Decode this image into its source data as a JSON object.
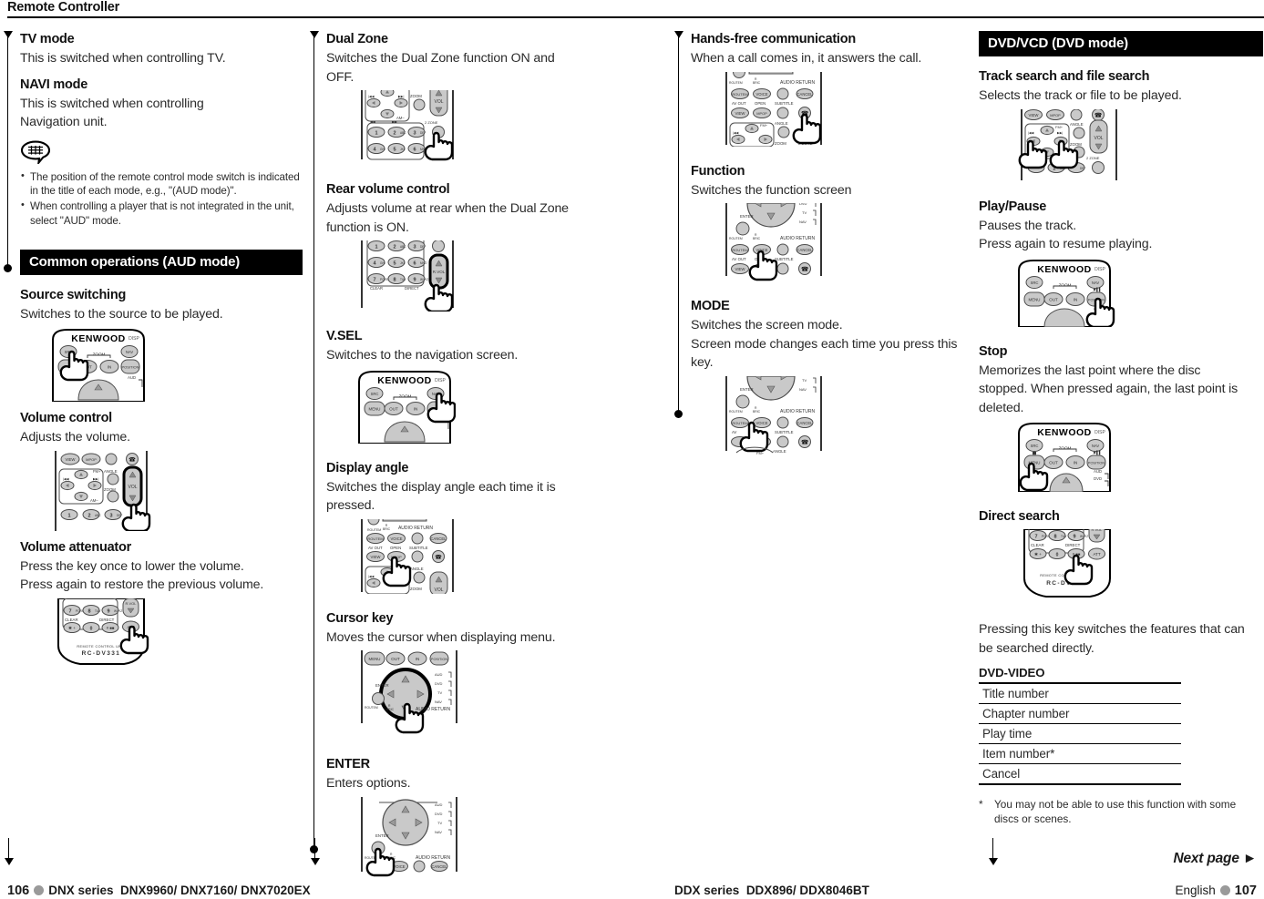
{
  "header": {
    "title": "Remote Controller"
  },
  "col1": {
    "items": [
      {
        "title": "TV mode",
        "desc": "This is switched when controlling TV."
      },
      {
        "title": "NAVI mode",
        "desc": "This is switched when controlling Navigation unit."
      }
    ],
    "note_icon": "note-balloon-icon",
    "notes": [
      "The position of the remote control mode switch is indicated in the title of each mode, e.g., \"(AUD mode)\".",
      "When controlling a player that is not integrated in the unit, select \"AUD\" mode."
    ],
    "section": "Common operations (AUD mode)",
    "ops": [
      {
        "title": "Source switching",
        "desc": "Switches to the source to be played.",
        "figure": "remote-top-src"
      },
      {
        "title": "Volume control",
        "desc": "Adjusts the volume.",
        "figure": "remote-mid-vol"
      },
      {
        "title": "Volume attenuator",
        "desc": "Press the key once to lower the volume.\nPress again to restore the previous volume.",
        "figure": "remote-bottom-att"
      }
    ]
  },
  "col2": {
    "items": [
      {
        "title": "Dual Zone",
        "desc": "Switches the Dual Zone function ON and OFF.",
        "figure": "remote-keypad-2zone"
      },
      {
        "title": "Rear volume control",
        "desc": "Adjusts volume at rear when the Dual Zone function is ON.",
        "figure": "remote-keypad-rvol"
      },
      {
        "title": "V.SEL",
        "desc": "Switches to the navigation screen.",
        "figure": "remote-top-nav"
      },
      {
        "title": "Display angle",
        "desc": "Switches the display angle each time it is pressed.",
        "figure": "remote-mid-angle"
      },
      {
        "title": "Cursor key",
        "desc": "Moves the cursor when displaying menu.",
        "figure": "remote-cursor-pad"
      },
      {
        "title": "ENTER",
        "desc": "Enters options.",
        "figure": "remote-enter-pad"
      }
    ]
  },
  "col3": {
    "items": [
      {
        "title": "Hands-free communication",
        "desc": "When a call comes in, it answers the call.",
        "figure": "remote-mid-call"
      },
      {
        "title": "Function",
        "desc": "Switches the function screen",
        "figure": "remote-mid-voice"
      },
      {
        "title": "MODE",
        "desc": "Switches the screen mode.\nScreen mode changes each time you press this key.",
        "figure": "remote-mid-routem"
      }
    ]
  },
  "col4": {
    "section": "DVD/VCD (DVD mode)",
    "items": [
      {
        "title": "Track search and file search",
        "desc": "Selects the track or file to be played.",
        "figure": "remote-arrows-lr"
      },
      {
        "title": "Play/Pause",
        "desc": "Pauses the track.\nPress again to resume playing.",
        "figure": "remote-top-playpause"
      },
      {
        "title": "Stop",
        "desc": "Memorizes the last point where the disc stopped. When pressed again, the last point is deleted.",
        "figure": "remote-top-menu"
      },
      {
        "title": "Direct search",
        "desc": "",
        "figure": "remote-bottom-direct"
      }
    ],
    "direct_search_desc": "Pressing this key switches the features that can be searched directly.",
    "table_title": "DVD-VIDEO",
    "table_rows": [
      "Title number",
      "Chapter number",
      "Play time",
      "Item number*",
      "Cancel"
    ],
    "footnote_marker": "*",
    "footnote": "You may not be able to use this function with some discs or scenes."
  },
  "footer": {
    "left_page": "106",
    "left_series_label": "DNX series",
    "left_models": "DNX9960/ DNX7160/ DNX7020EX",
    "mid_series_label": "DDX series",
    "mid_models": "DDX896/ DDX8046BT",
    "right_lang": "English",
    "right_page": "107",
    "next_page": "Next page",
    "next_page_icon": "triangle-right-icon"
  }
}
